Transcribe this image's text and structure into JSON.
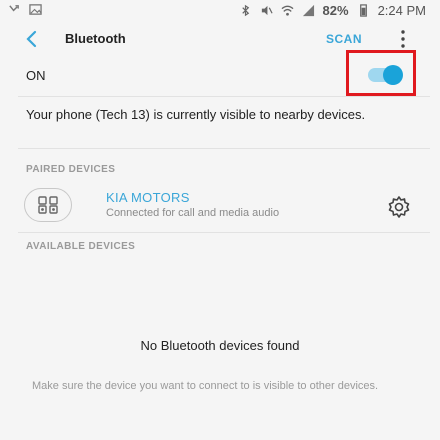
{
  "status_bar": {
    "left_icons": [
      "missed-call-icon",
      "image-icon"
    ],
    "right_icons": [
      "bluetooth-icon",
      "mute-icon",
      "wifi-icon",
      "signal-icon"
    ],
    "battery": "82%",
    "time": "2:24 PM"
  },
  "header": {
    "title": "Bluetooth",
    "scan_label": "SCAN"
  },
  "toggle": {
    "label": "ON",
    "state": "on",
    "accent": "#1aa3d9",
    "highlight_color": "#e0191f"
  },
  "visibility_text": "Your phone (Tech 13) is currently visible to nearby devices.",
  "paired": {
    "header": "PAIRED DEVICES",
    "devices": [
      {
        "name": "KIA MOTORS",
        "status": "Connected for call and media audio",
        "icon": "car-audio-icon"
      }
    ]
  },
  "available": {
    "header": "AVAILABLE DEVICES",
    "empty_title": "No Bluetooth devices found",
    "empty_hint": "Make sure the device you want to connect to is visible to other devices."
  }
}
